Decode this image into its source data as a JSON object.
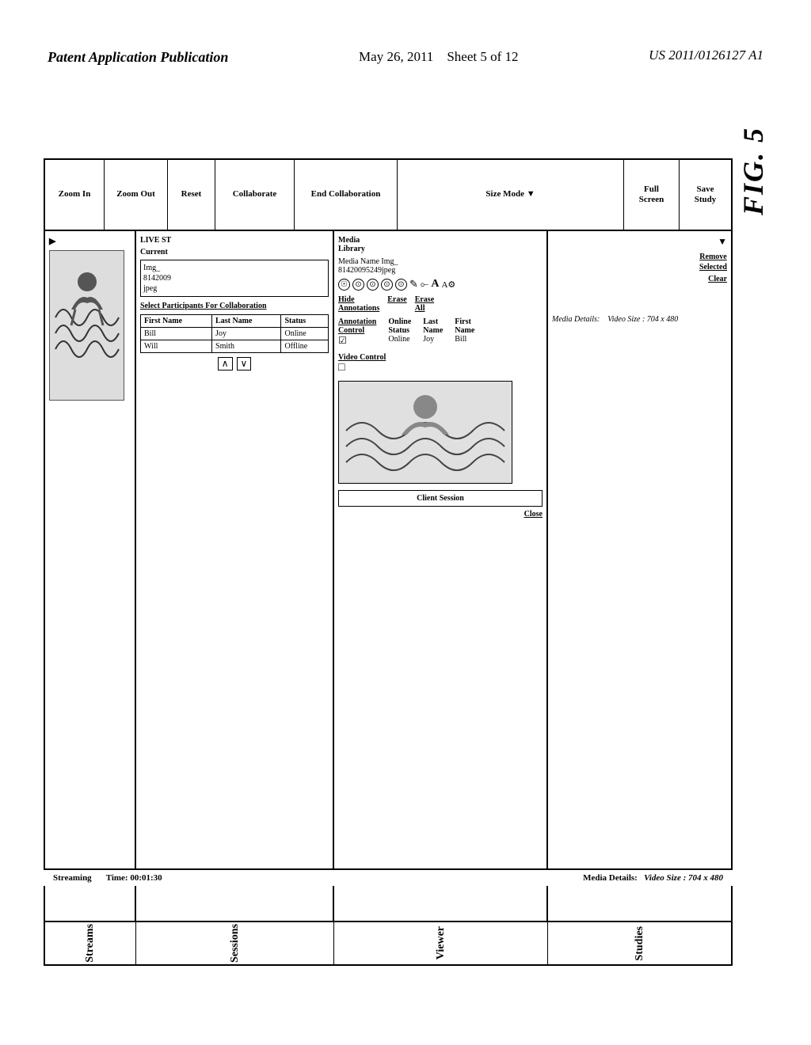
{
  "header": {
    "left": "Patent Application Publication",
    "center_date": "May 26, 2011",
    "center_sheet": "Sheet 5 of 12",
    "right": "US 2011/0126127 A1"
  },
  "fig_label": "FIG. 5",
  "toolbar": {
    "zoom_in": "Zoom In",
    "zoom_out": "Zoom Out",
    "reset": "Reset",
    "collaborate": "Collaborate",
    "end_collaboration": "End Collaboration",
    "size_mode": "Size Mode ▼",
    "save_study": "Save\nStudy",
    "full_screen": "Full\nScreen"
  },
  "sections": {
    "streams": "Streams",
    "sessions": "Sessions",
    "viewer": "Viewer",
    "studies": "Studies"
  },
  "streams_panel": {
    "arrow": "▶",
    "image_alt": "stream image"
  },
  "sessions_panel": {
    "live_label": "LIVE ST",
    "current_label": "Current",
    "current_image": "Img_\n8142009\njpeg",
    "select_title": "Select Participants For Collaboration",
    "table_headers": {
      "first_name": "First Name",
      "last_name": "Last Name",
      "status": "Status"
    },
    "participants": [
      {
        "first_name": "Bill",
        "last_name": "Joy",
        "status": "Online"
      },
      {
        "first_name": "Will",
        "last_name": "Smith",
        "status": "Offline"
      }
    ],
    "arrows": [
      "∧",
      "∨"
    ]
  },
  "collab_popup": {
    "media_library": "Media\nLibrary",
    "media_name": "Media Name Img_\n81420095249jpeg",
    "media_icons_labels": [
      "☉",
      "⊙",
      "⊙",
      "⊙",
      "⊙"
    ],
    "hide_label": "Hide\nAnnotations",
    "erase_label": "Erase",
    "pencil_icon": "✎",
    "eraser_icon": "⟜",
    "text_A": "A",
    "text_A_small": "A",
    "annotation_control": "Annotation\nControl",
    "annotation_check": "☑",
    "online_status_header": "Online\nStatus",
    "online_value": "Online",
    "first_name_header": "First\nName",
    "first_name_value": "Bill",
    "last_name_header": "Last\nName",
    "last_name_value": "Joy",
    "video_control": "Video Control",
    "video_checkbox": "□",
    "client_session": "Client Session",
    "close_label": "Close",
    "erase_all": "Erase\nAll"
  },
  "studies_panel": {
    "arrow": "▼",
    "remove_selected": "Remove\nSelected",
    "clear": "Clear",
    "media_details": "Media Details:",
    "video_size": "Video Size : 704 x 480",
    "time_label": "Time: 00:01:30"
  },
  "streaming_bar": {
    "label": "Streaming",
    "time": "Time: 00:01:30",
    "media_details": "Media Details:",
    "video_size": "Video Size : 704 x 480"
  }
}
